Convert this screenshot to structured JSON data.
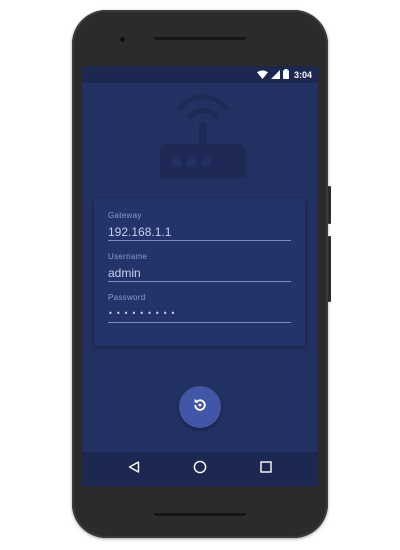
{
  "status_bar": {
    "time": "3:04",
    "icons": [
      "wifi-icon",
      "cellular-signal-icon",
      "battery-icon"
    ]
  },
  "header": {
    "illustration": "router-icon"
  },
  "form": {
    "gateway": {
      "label": "Gateway",
      "value": "192.168.1.1"
    },
    "username": {
      "label": "Username",
      "value": "admin"
    },
    "password": {
      "label": "Password",
      "value": "•••••••••"
    }
  },
  "fab": {
    "icon": "restart-icon"
  },
  "nav_bar": {
    "buttons": [
      "back-icon",
      "home-icon",
      "recents-icon"
    ]
  },
  "colors": {
    "background": "#233162",
    "status_bar": "#1c2851",
    "card": "#24336a",
    "accent": "#4156a6",
    "label": "#8d9bc8",
    "text": "#c8d0ee"
  }
}
